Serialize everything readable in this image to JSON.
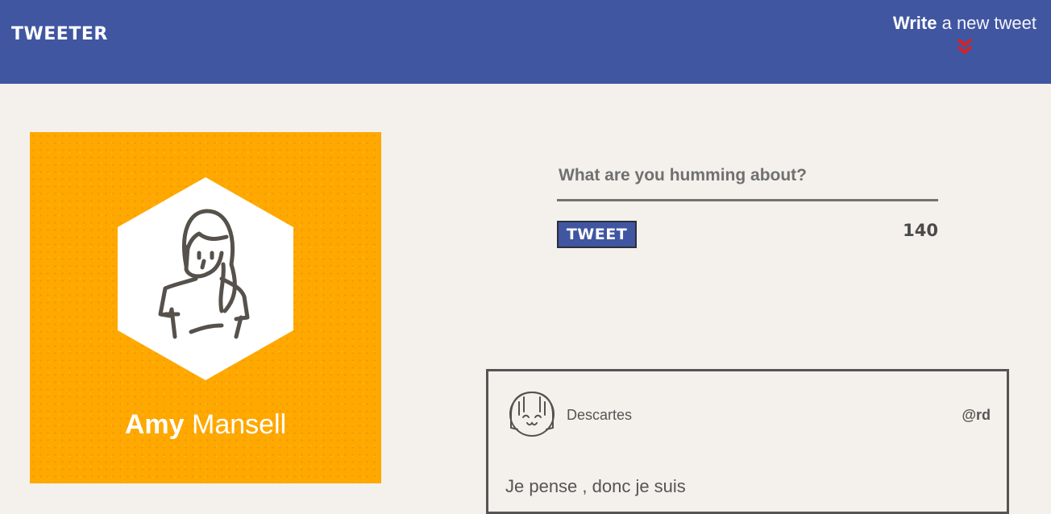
{
  "header": {
    "logo": "TWEETER",
    "compose_bold": "Write",
    "compose_rest": " a new tweet",
    "accent_color": "#4056a1",
    "arrow_color": "#e0201c"
  },
  "profile": {
    "first_name": "Amy",
    "last_name": " Mansell",
    "background": "#ffa800"
  },
  "composer": {
    "placeholder": "What are you humming about?",
    "button_label": "TWEET",
    "counter": "140"
  },
  "tweets": [
    {
      "name": "Descartes",
      "handle": "@rd",
      "text": "Je pense , donc je suis"
    }
  ]
}
